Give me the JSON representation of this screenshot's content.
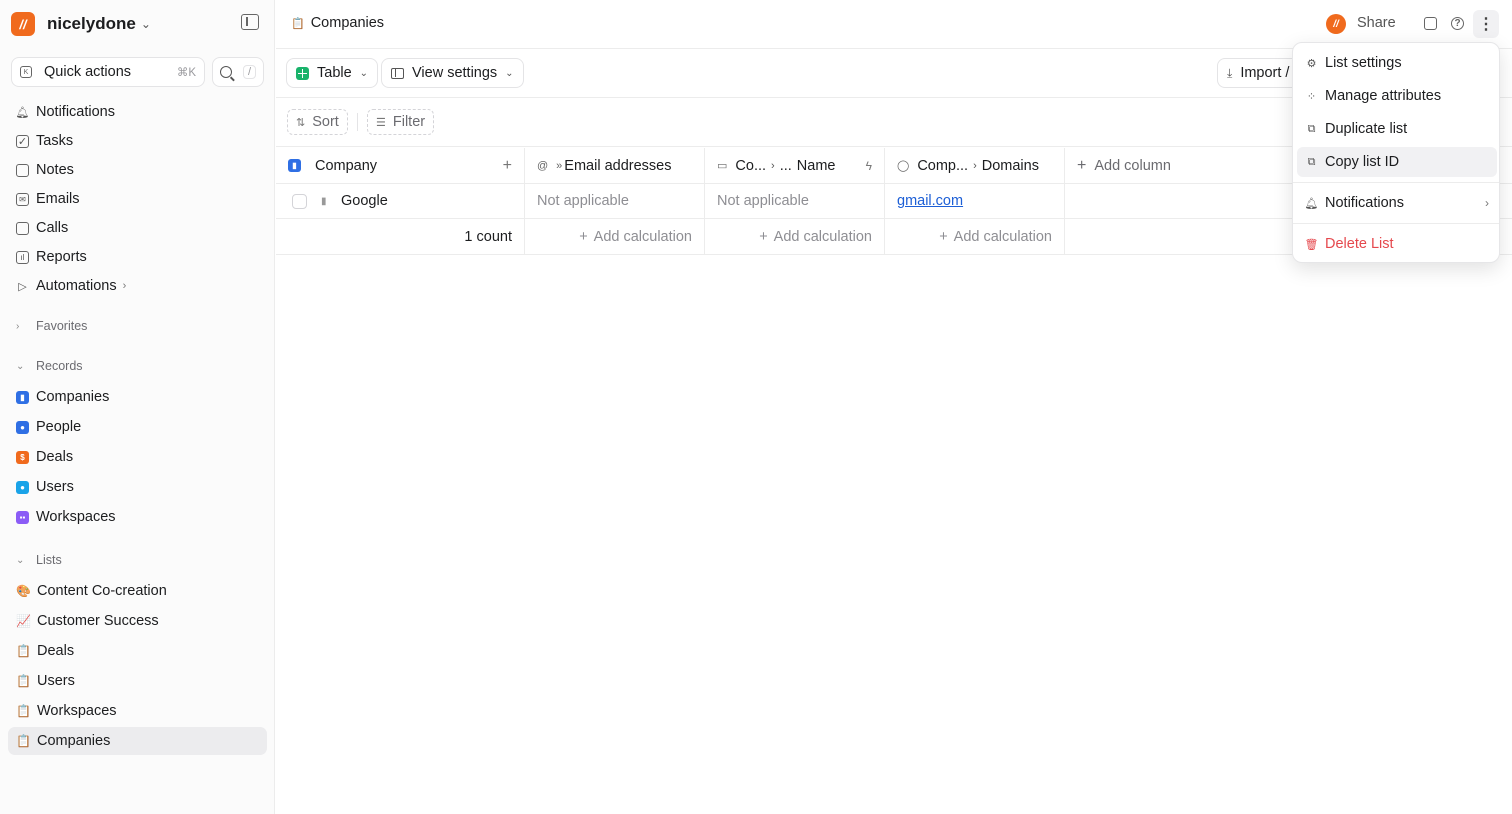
{
  "workspace": {
    "name": "nicelydone",
    "logo_letter": "//"
  },
  "quick_actions": {
    "label": "Quick actions",
    "shortcut": "⌘K",
    "search_shortcut": "/"
  },
  "nav": [
    {
      "label": "Notifications",
      "icon": "bell-icon"
    },
    {
      "label": "Tasks",
      "icon": "check-square-icon"
    },
    {
      "label": "Notes",
      "icon": "note-icon"
    },
    {
      "label": "Emails",
      "icon": "mail-icon"
    },
    {
      "label": "Calls",
      "icon": "video-icon"
    },
    {
      "label": "Reports",
      "icon": "report-icon"
    },
    {
      "label": "Automations",
      "icon": "play-icon"
    }
  ],
  "sections": {
    "favorites": "Favorites",
    "records": "Records",
    "lists": "Lists"
  },
  "records": [
    {
      "label": "Companies",
      "color": "#2f6fe4"
    },
    {
      "label": "People",
      "color": "#2f6fe4"
    },
    {
      "label": "Deals",
      "color": "#f06a1d"
    },
    {
      "label": "Users",
      "color": "#1aa3e8"
    },
    {
      "label": "Workspaces",
      "color": "#8b5cf6"
    }
  ],
  "lists": [
    {
      "label": "Content Co-creation",
      "emoji": "🎨"
    },
    {
      "label": "Customer Success",
      "emoji": "📈"
    },
    {
      "label": "Deals",
      "emoji": "📋"
    },
    {
      "label": "Users",
      "emoji": "📋"
    },
    {
      "label": "Workspaces",
      "emoji": "📋"
    },
    {
      "label": "Companies",
      "emoji": "📋"
    }
  ],
  "header": {
    "breadcrumb": "Companies",
    "share": "Share"
  },
  "toolbar": {
    "table": "Table",
    "view_settings": "View settings",
    "import": "Import /"
  },
  "filters": {
    "sort": "Sort",
    "filter": "Filter"
  },
  "table": {
    "columns": {
      "company": "Company",
      "email": "Email addresses",
      "co_1": "Co...",
      "co_2": "...",
      "name": "Name",
      "comp": "Comp...",
      "domains": "Domains",
      "add_column": "Add column"
    },
    "row": {
      "company": "Google",
      "email": "Not applicable",
      "name": "Not applicable",
      "domains": "gmail.com"
    },
    "footer": {
      "count": "1 count",
      "add_calc": "Add calculation"
    }
  },
  "menu": {
    "list_settings": "List settings",
    "manage_attributes": "Manage attributes",
    "duplicate_list": "Duplicate list",
    "copy_list_id": "Copy list ID",
    "notifications": "Notifications",
    "delete_list": "Delete List"
  },
  "colors": {
    "accent": "#f06a1d",
    "danger": "#e5484d",
    "link": "#1d5fd6",
    "table_green": "#19b36b"
  }
}
